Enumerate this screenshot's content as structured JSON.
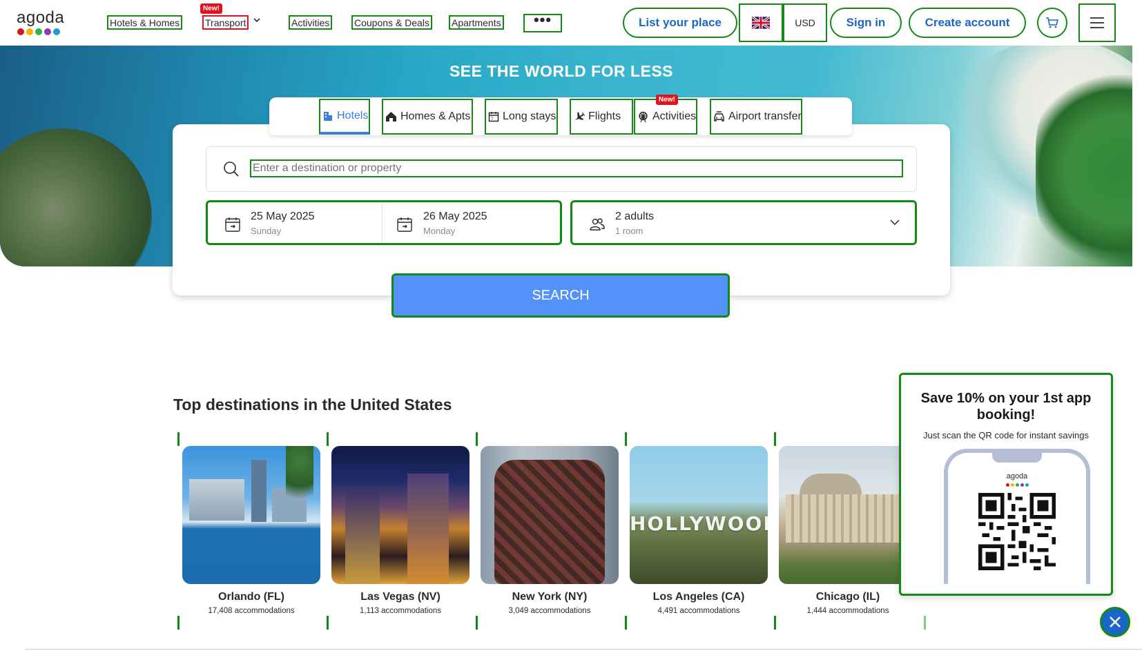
{
  "header": {
    "logo_text": "agoda",
    "logo_dot_colors": [
      "#e0121c",
      "#f7b500",
      "#2bb24c",
      "#8a3ab9",
      "#1b9bd7"
    ],
    "nav": [
      {
        "label": "Hotels & Homes"
      },
      {
        "label": "Transport",
        "badge": "New!"
      },
      {
        "label": "Activities"
      },
      {
        "label": "Coupons & Deals"
      },
      {
        "label": "Apartments"
      }
    ],
    "more_label": "•••",
    "list_place": "List your place",
    "language_icon": "uk-flag-icon",
    "currency": "USD",
    "sign_in": "Sign in",
    "create_account": "Create account",
    "cart_icon": "cart-icon",
    "menu_icon": "hamburger-menu-icon"
  },
  "hero": {
    "title": "SEE THE WORLD FOR LESS"
  },
  "tabs": [
    {
      "label": "Hotels",
      "icon": "hotel-icon",
      "active": true
    },
    {
      "label": "Homes & Apts",
      "icon": "home-icon"
    },
    {
      "label": "Long stays",
      "icon": "calendar-icon"
    },
    {
      "label": "Flights",
      "icon": "plane-icon"
    },
    {
      "label": "Activities",
      "icon": "ferris-wheel-icon",
      "badge": "New!"
    },
    {
      "label": "Airport transfer",
      "icon": "car-icon"
    }
  ],
  "search": {
    "placeholder": "Enter a destination or property",
    "checkin": {
      "date": "25 May 2025",
      "day": "Sunday"
    },
    "checkout": {
      "date": "26 May 2025",
      "day": "Monday"
    },
    "guests": {
      "main": "2 adults",
      "sub": "1 room"
    },
    "button": "SEARCH"
  },
  "destinations": {
    "title": "Top destinations in the United States",
    "items": [
      {
        "name": "Orlando (FL)",
        "count": "17,408 accommodations"
      },
      {
        "name": "Las Vegas (NV)",
        "count": "1,113 accommodations"
      },
      {
        "name": "New York (NY)",
        "count": "3,049 accommodations"
      },
      {
        "name": "Los Angeles (CA)",
        "count": "4,491 accommodations",
        "image_text": "HOLLYWOOD"
      },
      {
        "name": "Chicago (IL)",
        "count": "1,444 accommodations"
      }
    ]
  },
  "app_popup": {
    "title": "Save 10% on your 1st app booking!",
    "subtitle": "Just scan the QR code for instant savings",
    "phone_logo": "agoda"
  },
  "colors": {
    "accent_blue": "#1b66c9",
    "search_button": "#5392f9",
    "annotation_green": "#138a13",
    "badge_red": "#e0121c"
  }
}
